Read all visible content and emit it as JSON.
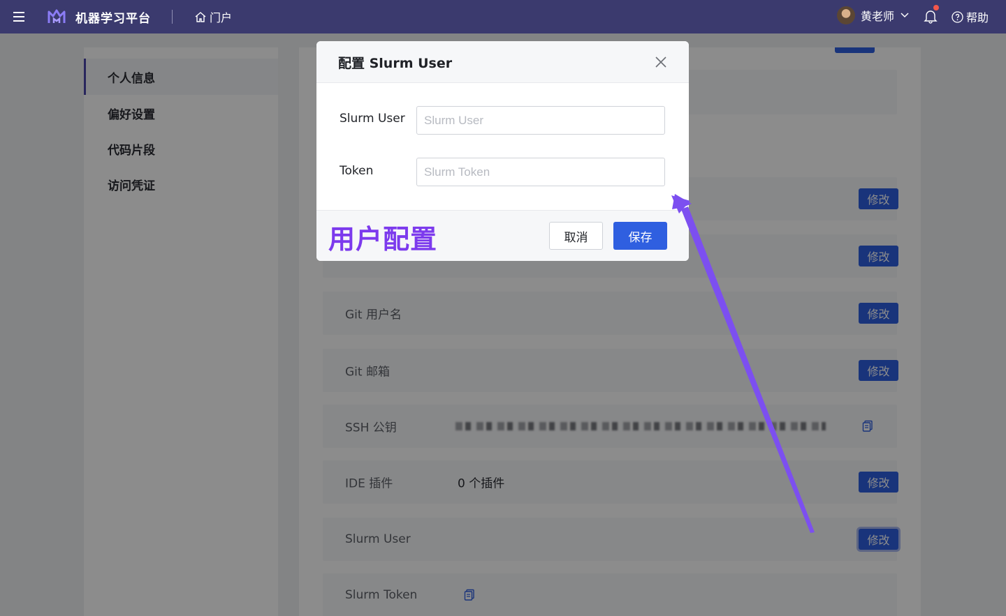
{
  "topbar": {
    "app_title": "机器学习平台",
    "portal_label": "门户",
    "user_name": "黄老师",
    "help_label": "帮助"
  },
  "sidebar": {
    "items": [
      {
        "label": "个人信息",
        "active": true
      },
      {
        "label": "偏好设置",
        "active": false
      },
      {
        "label": "代码片段",
        "active": false
      },
      {
        "label": "访问凭证",
        "active": false
      }
    ]
  },
  "settings": {
    "edit_label": "修改",
    "rows": [
      {
        "label": "Git 用户名",
        "value": ""
      },
      {
        "label": "Git 邮箱",
        "value": ""
      },
      {
        "label": "SSH 公钥",
        "value": ""
      },
      {
        "label": "IDE 插件",
        "value": "0 个插件"
      },
      {
        "label": "Slurm User",
        "value": ""
      },
      {
        "label": "Slurm Token",
        "value": ""
      }
    ]
  },
  "modal": {
    "title": "配置 Slurm User",
    "fields": [
      {
        "label": "Slurm User",
        "placeholder": "Slurm User",
        "value": ""
      },
      {
        "label": "Token",
        "placeholder": "Slurm Token",
        "value": ""
      }
    ],
    "cancel_label": "取消",
    "save_label": "保存"
  },
  "annotation": {
    "text": "用户配置",
    "color": "#7c3aed"
  },
  "colors": {
    "topbar_bg": "#3b3a6e",
    "primary": "#2f5fe0",
    "notification_dot": "#f5574b"
  }
}
